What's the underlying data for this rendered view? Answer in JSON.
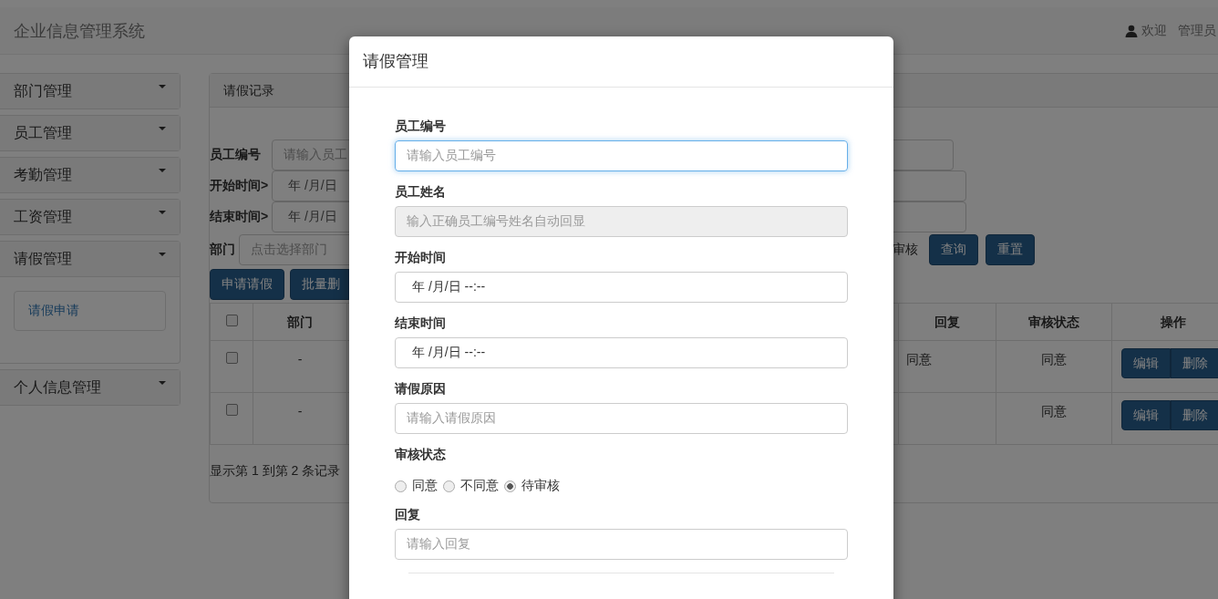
{
  "navbar": {
    "title": "企业信息管理系统",
    "welcome": "欢迎",
    "user": "管理员"
  },
  "sidebar": {
    "items": [
      {
        "label": "部门管理"
      },
      {
        "label": "员工管理"
      },
      {
        "label": "考勤管理"
      },
      {
        "label": "工资管理"
      },
      {
        "label": "请假管理",
        "children": [
          {
            "label": "请假申请"
          }
        ]
      },
      {
        "label": "个人信息管理"
      }
    ]
  },
  "panel": {
    "heading": "请假记录",
    "filters": [
      {
        "label": "员工编号",
        "placeholder": "请输入员工"
      },
      {
        "label": "开始时间>",
        "value": "年 /月/日"
      },
      {
        "label": "结束时间>",
        "value": "年 /月/日"
      },
      {
        "label": "部门",
        "placeholder": "点击选择部门"
      }
    ],
    "status_text": "审核",
    "buttons": [
      "查询",
      "重置"
    ],
    "actions": [
      "申请请假",
      "批量删"
    ],
    "table": {
      "select_all_checked": false,
      "columns": [
        "部门",
        "回复",
        "审核状态",
        "操作"
      ],
      "rows": [
        {
          "checked": false,
          "cells": [
            "-",
            "同意",
            "同意"
          ],
          "buttons": [
            "编辑",
            "删除"
          ]
        },
        {
          "checked": false,
          "cells": [
            "-",
            "",
            "同意"
          ],
          "buttons": [
            "编辑",
            "删除"
          ]
        }
      ]
    },
    "footer": "显示第 1 到第 2 条记录"
  },
  "modal": {
    "title": "请假管理",
    "fields": [
      {
        "kind": "text",
        "label": "员工编号",
        "placeholder": "请输入员工编号",
        "focused": true,
        "disabled": false
      },
      {
        "kind": "text",
        "label": "员工姓名",
        "placeholder": "输入正确员工编号姓名自动回显",
        "focused": false,
        "disabled": true
      },
      {
        "kind": "datetime",
        "label": "开始时间",
        "value": "年 /月/日  --:--"
      },
      {
        "kind": "datetime",
        "label": "结束时间",
        "value": "年 /月/日  --:--"
      },
      {
        "kind": "text",
        "label": "请假原因",
        "placeholder": "请输入请假原因",
        "focused": false,
        "disabled": false
      },
      {
        "kind": "radio",
        "label": "审核状态",
        "options": [
          {
            "label": "同意",
            "selected": false
          },
          {
            "label": "不同意",
            "selected": false
          },
          {
            "label": "待审核",
            "selected": true
          }
        ]
      },
      {
        "kind": "text",
        "label": "回复",
        "placeholder": "请输入回复",
        "focused": false,
        "disabled": false
      }
    ]
  }
}
